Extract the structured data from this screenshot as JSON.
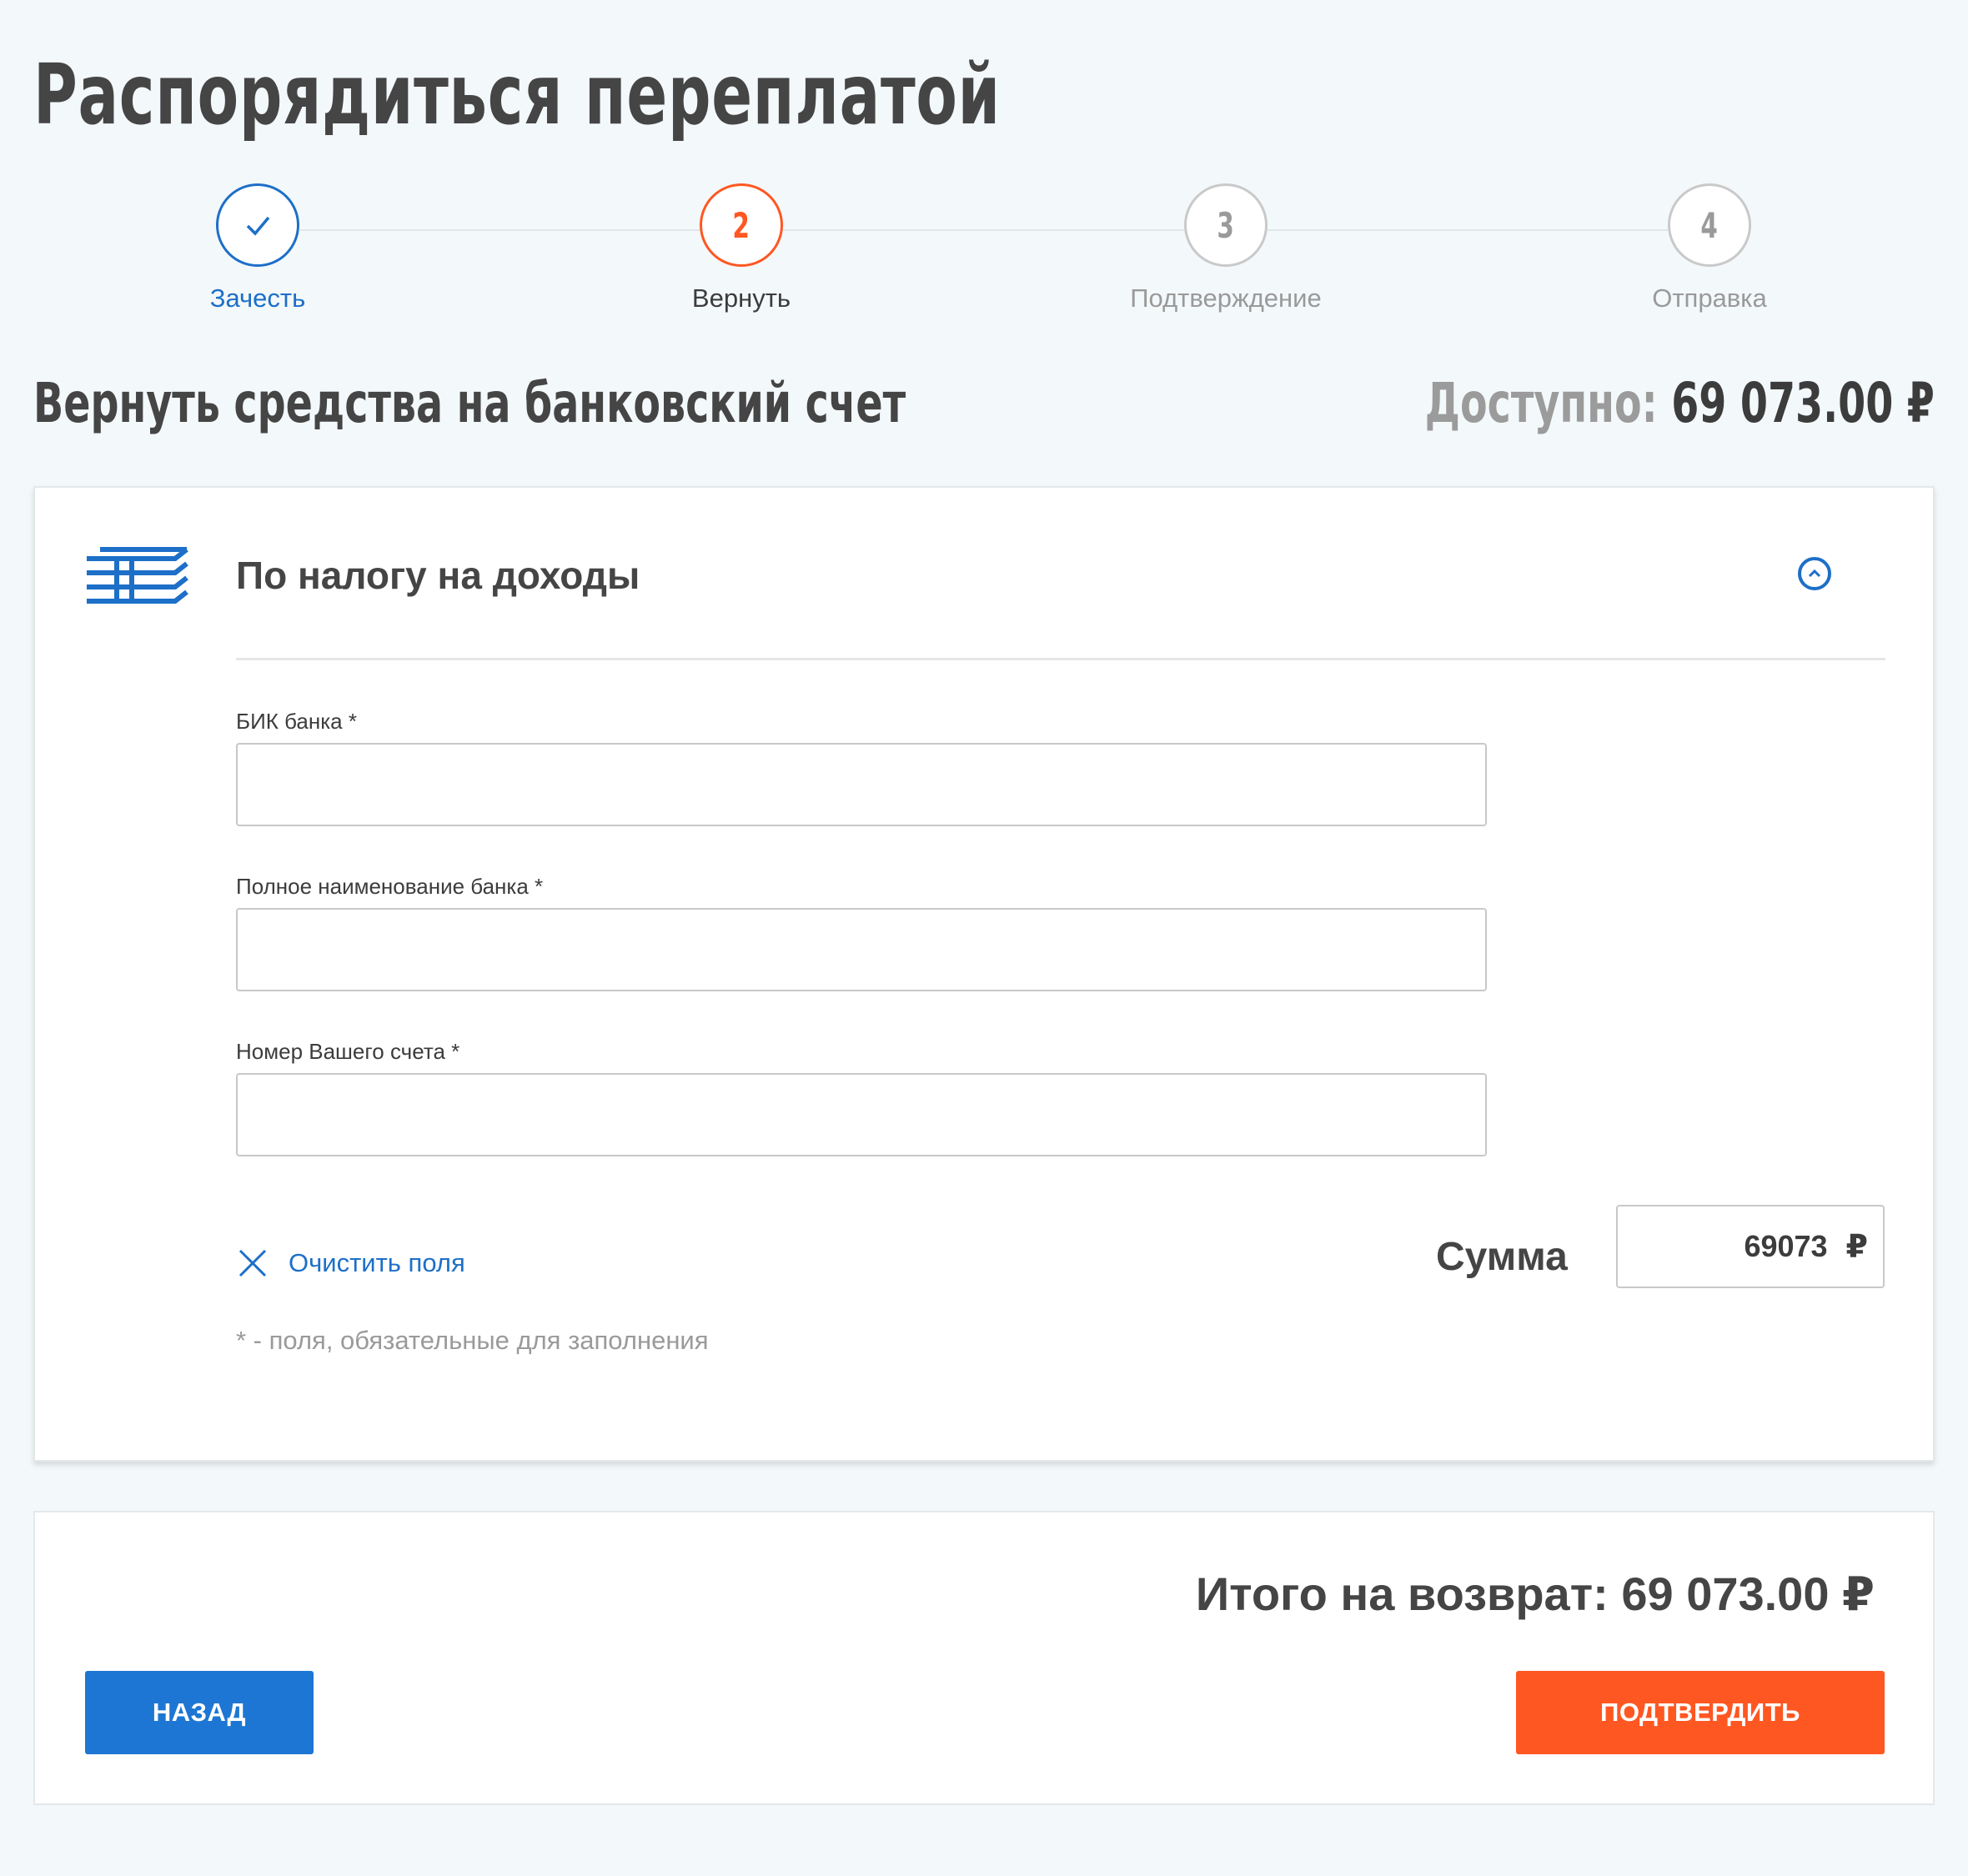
{
  "page": {
    "title": "Распорядиться переплатой"
  },
  "stepper": {
    "steps": [
      {
        "number": "1",
        "label": "Зачесть",
        "state": "done"
      },
      {
        "number": "2",
        "label": "Вернуть",
        "state": "active"
      },
      {
        "number": "3",
        "label": "Подтверждение",
        "state": "pending"
      },
      {
        "number": "4",
        "label": "Отправка",
        "state": "pending"
      }
    ]
  },
  "section": {
    "title": "Вернуть средства на банковский счет",
    "available_label": "Доступно:",
    "available_value": "69 073.00 ₽"
  },
  "tax_card": {
    "icon": "tax-layers-icon",
    "title": "По налогу на доходы",
    "fields": [
      {
        "label": "БИК банка *",
        "value": "",
        "placeholder": ""
      },
      {
        "label": "Полное наименование банка *",
        "value": "",
        "placeholder": ""
      },
      {
        "label": "Номер Вашего счета *",
        "value": "",
        "placeholder": ""
      }
    ],
    "clear_label": "Очистить поля",
    "sum_label": "Сумма",
    "sum_value": "69073",
    "sum_currency": "₽",
    "required_note": "* - поля, обязательные для заполнения"
  },
  "footer": {
    "total_label": "Итого на возврат:",
    "total_value": "69 073.00 ₽",
    "back_label": "НАЗАД",
    "confirm_label": "ПОДТВЕРДИТЬ"
  },
  "colors": {
    "background": "#f3f8fa",
    "accent_blue": "#1d6fc8",
    "accent_orange": "#ff5722",
    "text_dark": "#454545",
    "text_muted": "#9a9a9a"
  }
}
